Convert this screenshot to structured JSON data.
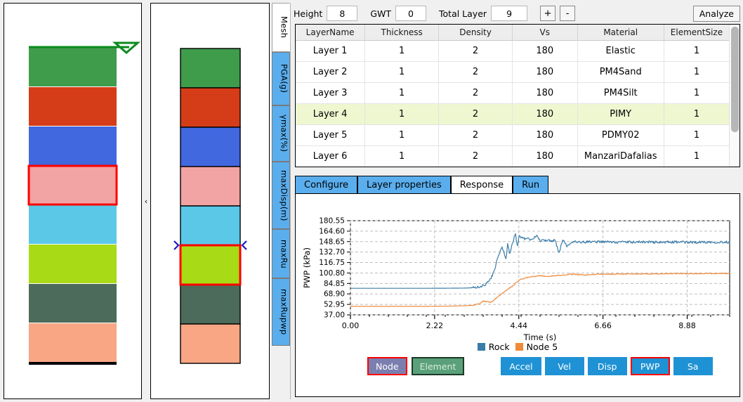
{
  "topbar": {
    "height_label": "Height",
    "height_value": "8",
    "gwt_label": "GWT",
    "gwt_value": "0",
    "total_layer_label": "Total Layer",
    "total_layer_value": "9",
    "plus_label": "+",
    "minus_label": "-",
    "analyze_label": "Analyze"
  },
  "vertical_tabs": [
    {
      "label": "Mesh",
      "active": true
    },
    {
      "label": "PGA(g)",
      "active": false
    },
    {
      "label": "γmax(%)",
      "active": false
    },
    {
      "label": "maxDisp(m)",
      "active": false
    },
    {
      "label": "maxRu",
      "active": false
    },
    {
      "label": "maxRupwp",
      "active": false
    }
  ],
  "collapse_handle_label": "‹",
  "soil_column_left": {
    "water_table_marker": "water-table-triangle",
    "selected_index": 3,
    "layers": [
      {
        "color": "#3f9c4b"
      },
      {
        "color": "#d53d18"
      },
      {
        "color": "#4268e0"
      },
      {
        "color": "#f2a3a3"
      },
      {
        "color": "#5bc8e8"
      },
      {
        "color": "#a9da16"
      },
      {
        "color": "#4d6b5a"
      },
      {
        "color": "#f8a684"
      }
    ]
  },
  "soil_column_mid": {
    "selected_index": 5,
    "marker_label": "selection-arrow",
    "layers": [
      {
        "color": "#3f9c4b"
      },
      {
        "color": "#d53d18"
      },
      {
        "color": "#4268e0"
      },
      {
        "color": "#f2a3a3"
      },
      {
        "color": "#5bc8e8"
      },
      {
        "color": "#a9da16"
      },
      {
        "color": "#4d6b5a"
      },
      {
        "color": "#f8a684"
      }
    ]
  },
  "table": {
    "columns": [
      "LayerName",
      "Thickness",
      "Density",
      "Vs",
      "Material",
      "ElementSize"
    ],
    "selected_row": 3,
    "rows": [
      [
        "Layer 1",
        "1",
        "2",
        "180",
        "Elastic",
        "1"
      ],
      [
        "Layer 2",
        "1",
        "2",
        "180",
        "PM4Sand",
        "1"
      ],
      [
        "Layer 3",
        "1",
        "2",
        "180",
        "PM4Silt",
        "1"
      ],
      [
        "Layer 4",
        "1",
        "2",
        "180",
        "PIMY",
        "1"
      ],
      [
        "Layer 5",
        "1",
        "2",
        "180",
        "PDMY02",
        "1"
      ],
      [
        "Layer 6",
        "1",
        "2",
        "180",
        "ManzariDafalias",
        "1"
      ]
    ]
  },
  "main_tabs": [
    {
      "label": "Configure",
      "active": false
    },
    {
      "label": "Layer properties",
      "active": false
    },
    {
      "label": "Response",
      "active": true
    },
    {
      "label": "Run",
      "active": false
    }
  ],
  "response_buttons": {
    "group_a": [
      {
        "label": "Node",
        "bg": "#7b7fb0",
        "border": "#ff0000",
        "text": "#ffffff"
      },
      {
        "label": "Element",
        "bg": "#5aa07a",
        "border": "#1d3b27",
        "text": "#d9ecd9"
      }
    ],
    "group_b": [
      {
        "label": "Accel",
        "bg": "#1e92d4",
        "border": "#1e92d4",
        "text": "#ffffff"
      },
      {
        "label": "Vel",
        "bg": "#1e92d4",
        "border": "#1e92d4",
        "text": "#ffffff"
      },
      {
        "label": "Disp",
        "bg": "#1e92d4",
        "border": "#1e92d4",
        "text": "#ffffff"
      },
      {
        "label": "PWP",
        "bg": "#1e92d4",
        "border": "#ff0000",
        "text": "#ffffff"
      },
      {
        "label": "Sa",
        "bg": "#1e92d4",
        "border": "#1e92d4",
        "text": "#ffffff"
      }
    ]
  },
  "chart_data": {
    "type": "line",
    "title": "",
    "xlabel": "Time (s)",
    "ylabel": "PWP (kPa)",
    "xlim": [
      0.0,
      10.0
    ],
    "ylim": [
      37.0,
      180.55
    ],
    "xticks": [
      "0.00",
      "2.22",
      "4.44",
      "6.66",
      "8.88"
    ],
    "xtick_values": [
      0.0,
      2.22,
      4.44,
      6.66,
      8.88
    ],
    "yticks": [
      "180.55",
      "164.60",
      "148.65",
      "132.70",
      "116.75",
      "100.80",
      "84.85",
      "68.90",
      "52.95",
      "37.00"
    ],
    "ytick_values": [
      180.55,
      164.6,
      148.65,
      132.7,
      116.75,
      100.8,
      84.85,
      68.9,
      52.95,
      37.0
    ],
    "grid": true,
    "legend_position": "below",
    "series": [
      {
        "name": "Rock",
        "color": "#3a7ca8",
        "x": [
          0.0,
          0.5,
          1.0,
          1.5,
          2.0,
          2.5,
          3.0,
          3.2,
          3.4,
          3.55,
          3.7,
          3.8,
          3.9,
          4.0,
          4.1,
          4.15,
          4.2,
          4.3,
          4.35,
          4.4,
          4.45,
          4.5,
          4.6,
          4.7,
          4.8,
          4.9,
          5.0,
          5.1,
          5.2,
          5.3,
          5.4,
          5.5,
          5.6,
          5.7,
          5.8,
          5.9,
          6.0,
          6.2,
          6.4,
          6.6,
          6.8,
          7.0,
          7.4,
          7.8,
          8.2,
          8.6,
          9.0,
          9.4,
          9.8,
          10.0
        ],
        "y": [
          77.5,
          77.5,
          77.5,
          77.5,
          77.5,
          77.6,
          77.8,
          78.2,
          79.5,
          83.0,
          92.0,
          105.0,
          128.0,
          140.0,
          122.0,
          147.0,
          130.0,
          152.0,
          162.0,
          140.0,
          158.0,
          155.0,
          153.0,
          152.5,
          152.0,
          158.0,
          150.0,
          150.5,
          151.0,
          150.0,
          150.5,
          131.0,
          152.0,
          142.0,
          146.0,
          148.0,
          147.5,
          148.0,
          148.5,
          148.0,
          148.2,
          148.0,
          147.8,
          148.2,
          147.5,
          148.0,
          147.6,
          148.0,
          147.8,
          148.0
        ]
      },
      {
        "name": "Node 5",
        "color": "#ef8a3a",
        "x": [
          0.0,
          0.5,
          1.0,
          1.5,
          2.0,
          2.5,
          3.0,
          3.2,
          3.4,
          3.5,
          3.6,
          3.7,
          3.8,
          3.85,
          3.9,
          4.0,
          4.1,
          4.2,
          4.3,
          4.4,
          4.5,
          4.6,
          4.7,
          4.8,
          4.9,
          5.0,
          5.2,
          5.4,
          5.6,
          5.8,
          6.0,
          6.2,
          6.4,
          6.6,
          7.0,
          7.4,
          7.8,
          8.2,
          8.6,
          9.0,
          9.4,
          9.8,
          10.0
        ],
        "y": [
          50.0,
          50.0,
          50.0,
          50.0,
          50.0,
          50.2,
          50.8,
          51.5,
          54.0,
          58.0,
          57.0,
          56.0,
          60.0,
          63.0,
          65.0,
          70.0,
          74.0,
          78.0,
          82.0,
          88.0,
          91.0,
          93.0,
          94.0,
          95.5,
          96.0,
          96.5,
          95.5,
          96.5,
          97.5,
          99.0,
          98.5,
          98.0,
          98.5,
          99.0,
          99.2,
          99.5,
          99.3,
          99.8,
          100.0,
          99.6,
          100.2,
          100.0,
          100.3
        ]
      }
    ]
  }
}
